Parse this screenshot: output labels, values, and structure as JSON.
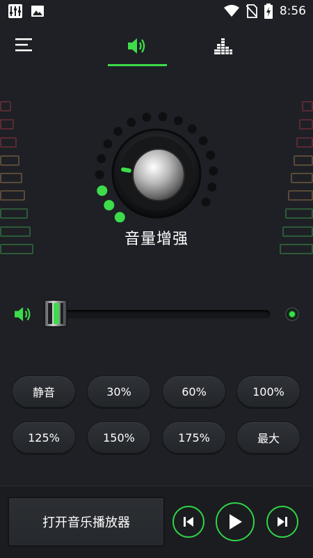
{
  "status_bar": {
    "time": "8:56",
    "left_icons": [
      "equalizer-app-icon",
      "image-icon"
    ],
    "right_icons": [
      "wifi-icon",
      "no-sim-icon",
      "battery-charging-icon"
    ]
  },
  "top_nav": {
    "icons": [
      "menu-icon",
      "volume-icon",
      "equalizer-icon"
    ],
    "active_tab": "volume"
  },
  "colors": {
    "accent": "#3ddc4a",
    "background": "#1e2025",
    "button": "#2a2d31"
  },
  "knob": {
    "label": "音量增强",
    "active_dots": 3,
    "total_dots": 17
  },
  "volume_slider": {
    "level": 0.0
  },
  "presets": [
    "静音",
    "30%",
    "60%",
    "100%",
    "125%",
    "150%",
    "175%",
    "最大"
  ],
  "bottom": {
    "open_player_label": "打开音乐播放器",
    "controls": [
      "previous-icon",
      "play-icon",
      "next-icon"
    ]
  }
}
